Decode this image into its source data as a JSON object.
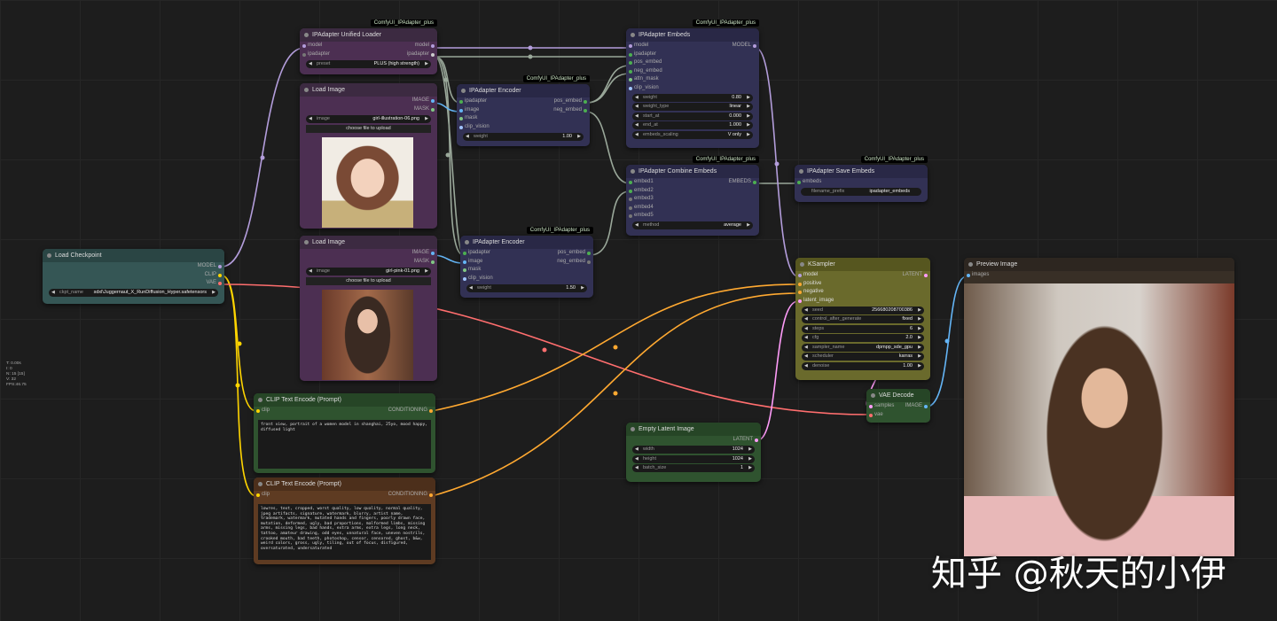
{
  "stats": [
    "T: 0.00s",
    "I: 0",
    "N: 15 [15]",
    "V: 32",
    "FPS:46.75"
  ],
  "badge": "ComfyUI_IPAdapter_plus",
  "watermark": "知乎 @秋天的小伊",
  "colors": {
    "model": "#b39ddb",
    "clip": "#ffd500",
    "vae": "#ff6e6e",
    "conditioning": "#ffa931",
    "latent": "#ff9cf9",
    "image": "#64b5f6",
    "ipadapter": "#9aa89a"
  },
  "checkpoint": {
    "title": "Load Checkpoint",
    "outputs": [
      "MODEL",
      "CLIP",
      "VAE"
    ],
    "widget": {
      "label": "ckpt_name",
      "value": "sdxl\\Juggernaut_X_RunDiffusion_Hyper.safetensors"
    }
  },
  "loader": {
    "title": "IPAdapter Unified Loader",
    "inputs": [
      "model",
      "ipadapter"
    ],
    "outputs": [
      "model",
      "ipadapter"
    ],
    "widget": {
      "label": "preset",
      "value": "PLUS (high strength)"
    }
  },
  "image1": {
    "title": "Load Image",
    "outputs": [
      "IMAGE",
      "MASK"
    ],
    "widget": {
      "label": "image",
      "value": "girl-illustration-06.png"
    },
    "upload": "choose file to upload"
  },
  "image2": {
    "title": "Load Image",
    "outputs": [
      "IMAGE",
      "MASK"
    ],
    "widget": {
      "label": "image",
      "value": "girl-pink-01.png"
    },
    "upload": "choose file to upload"
  },
  "encoder1": {
    "title": "IPAdapter Encoder",
    "inputs": [
      "ipadapter",
      "image",
      "mask",
      "clip_vision"
    ],
    "outputs": [
      "pos_embed",
      "neg_embed"
    ],
    "widget": {
      "label": "weight",
      "value": "1.00"
    }
  },
  "encoder2": {
    "title": "IPAdapter Encoder",
    "inputs": [
      "ipadapter",
      "image",
      "mask",
      "clip_vision"
    ],
    "outputs": [
      "pos_embed",
      "neg_embed"
    ],
    "widget": {
      "label": "weight",
      "value": "1.50"
    }
  },
  "embeds": {
    "title": "IPAdapter Embeds",
    "inputs": [
      "model",
      "ipadapter",
      "pos_embed",
      "neg_embed",
      "attn_mask",
      "clip_vision"
    ],
    "output": "MODEL",
    "widgets": [
      {
        "label": "weight",
        "value": "0.80"
      },
      {
        "label": "weight_type",
        "value": "linear"
      },
      {
        "label": "start_at",
        "value": "0.000"
      },
      {
        "label": "end_at",
        "value": "1.000"
      },
      {
        "label": "embeds_scaling",
        "value": "V only"
      }
    ]
  },
  "combine": {
    "title": "IPAdapter Combine Embeds",
    "inputs": [
      "embed1",
      "embed2",
      "embed3",
      "embed4",
      "embed5"
    ],
    "output": "EMBEDS",
    "widget": {
      "label": "method",
      "value": "average"
    }
  },
  "save": {
    "title": "IPAdapter Save Embeds",
    "input": "embeds",
    "widget": {
      "label": "filename_prefix",
      "value": "ipadapter_embeds"
    }
  },
  "ksampler": {
    "title": "KSampler",
    "inputs": [
      "model",
      "positive",
      "negative",
      "latent_image"
    ],
    "output": "LATENT",
    "widgets": [
      {
        "label": "seed",
        "value": "256680208700386"
      },
      {
        "label": "control_after_generate",
        "value": "fixed"
      },
      {
        "label": "steps",
        "value": "6"
      },
      {
        "label": "cfg",
        "value": "2.0"
      },
      {
        "label": "sampler_name",
        "value": "dpmpp_sde_gpu"
      },
      {
        "label": "scheduler",
        "value": "karras"
      },
      {
        "label": "denoise",
        "value": "1.00"
      }
    ]
  },
  "vaedecode": {
    "title": "VAE Decode",
    "inputs": [
      "samples",
      "vae"
    ],
    "output": "IMAGE"
  },
  "latent": {
    "title": "Empty Latent Image",
    "output": "LATENT",
    "widgets": [
      {
        "label": "width",
        "value": "1024"
      },
      {
        "label": "height",
        "value": "1024"
      },
      {
        "label": "batch_size",
        "value": "1"
      }
    ]
  },
  "preview": {
    "title": "Preview Image",
    "input": "images"
  },
  "clippos": {
    "title": "CLIP Text Encode (Prompt)",
    "input": "clip",
    "output": "CONDITIONING",
    "text": "front view, portrait of a women model in shanghai, 25yo, mood happy, diffused light"
  },
  "clipneg": {
    "title": "CLIP Text Encode (Prompt)",
    "input": "clip",
    "output": "CONDITIONING",
    "text": "lowres, text, cropped, worst quality, low quality, normal quality, jpeg artifacts, signature, watermark, blurry, artist name, trademark, watermark, mutated hands and fingers, poorly drawn face, mutation, deformed, ugly, bad proportions, malformed limbs, missing arms, missing legs, bad hands, extra arms, extra legs, long neck, tattoo, amateur drawing, odd eyes, unnatural face, uneven nostrils, crooked mouth, bad teeth, photoshop, censor, censored, ghost, b&w, weird colors, gross, ugly, tiling, out of focus, disfigured, oversaturated, undersaturated"
  }
}
